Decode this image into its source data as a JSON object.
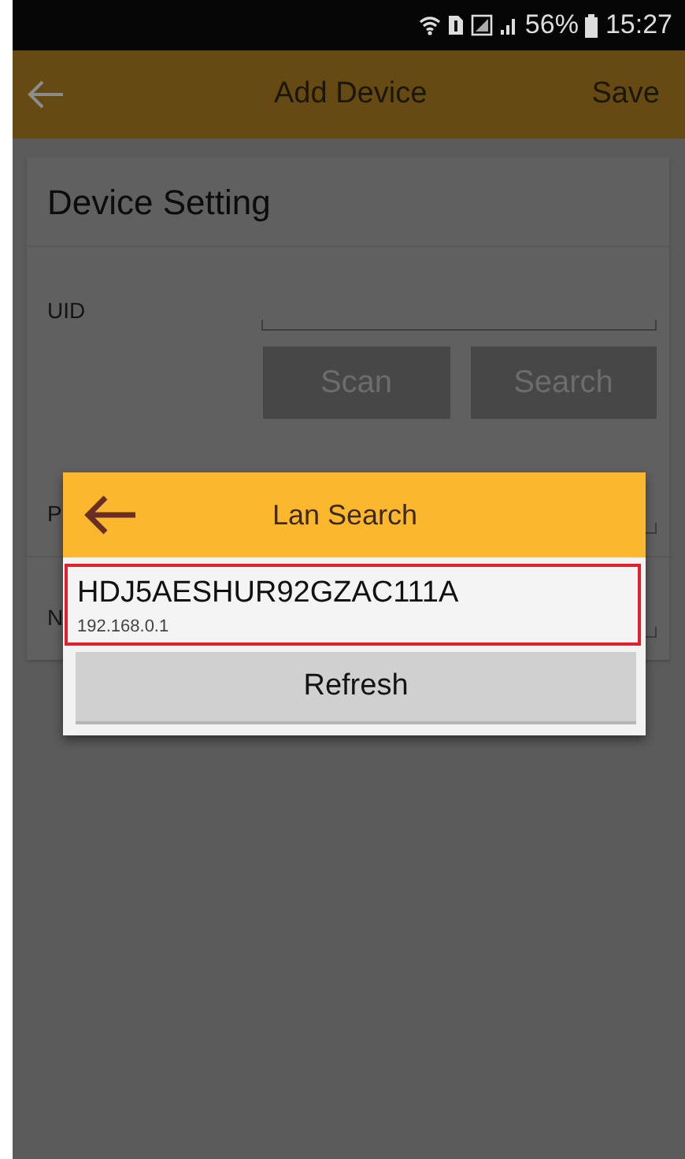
{
  "status_bar": {
    "battery": "56%",
    "time": "15:27"
  },
  "app_bar": {
    "title": "Add Device",
    "action": "Save"
  },
  "device_setting": {
    "title": "Device Setting",
    "uid_label": "UID",
    "buttons": [
      "Scan",
      "Search"
    ],
    "hidden_labels": [
      "P",
      "N"
    ]
  },
  "dialog": {
    "title": "Lan Search",
    "devices": [
      {
        "uid": "HDJ5AESHUR92GZAC111A",
        "ip": "192.168.0.1",
        "selected": true
      }
    ],
    "refresh": "Refresh"
  }
}
